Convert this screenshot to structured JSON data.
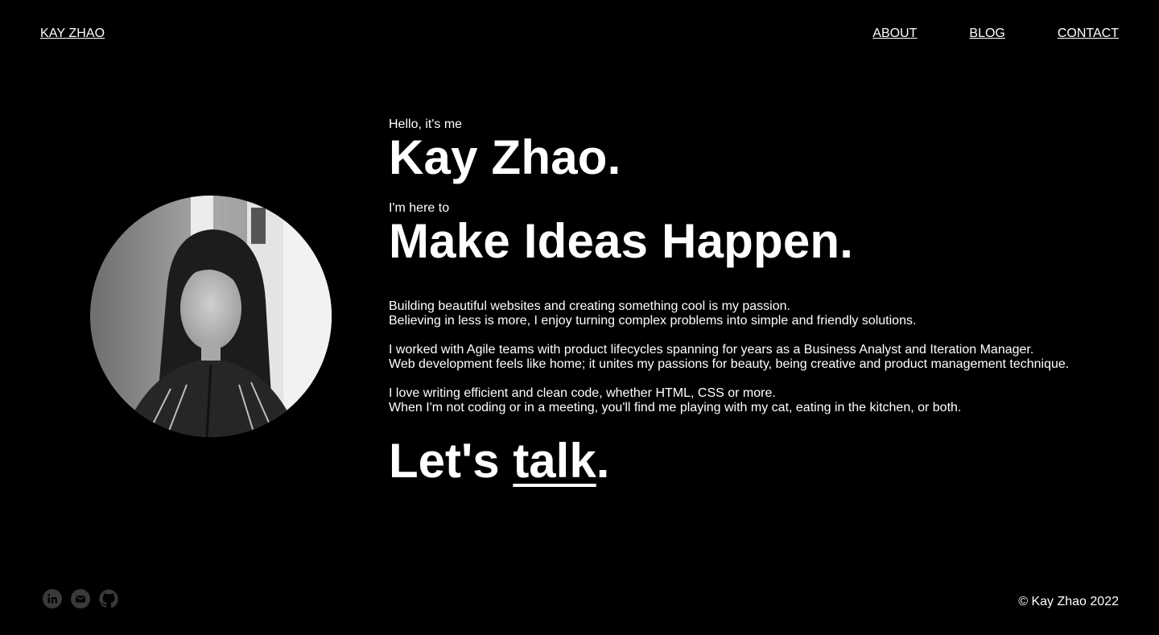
{
  "header": {
    "logo": "KAY ZHAO",
    "nav": [
      "ABOUT",
      "BLOG",
      "CONTACT"
    ]
  },
  "hero": {
    "greeting": "Hello, it's me",
    "name": "Kay Zhao.",
    "intro": "I'm here to",
    "tagline": "Make Ideas Happen."
  },
  "bio": [
    [
      "Building beautiful websites and creating something cool is my passion.",
      "Believing in less is more, I enjoy turning complex problems into simple and friendly solutions."
    ],
    [
      "I worked with Agile teams with product lifecycles spanning for years as a Business Analyst and Iteration Manager.",
      "Web development feels like home; it unites my passions for beauty, being creative and product management technique."
    ],
    [
      "I love writing efficient and clean code, whether HTML, CSS or more.",
      "When I'm not coding or in a meeting, you'll find me playing with my cat, eating in the kitchen, or both."
    ]
  ],
  "cta": {
    "prefix": "Let's ",
    "link": "talk",
    "suffix": "."
  },
  "footer": {
    "social_icons": [
      "linkedin-icon",
      "email-icon",
      "github-icon"
    ],
    "copyright": "© Kay Zhao 2022"
  },
  "colors": {
    "background": "#000000",
    "text": "#ffffff",
    "icon": "#3a3a3a"
  }
}
